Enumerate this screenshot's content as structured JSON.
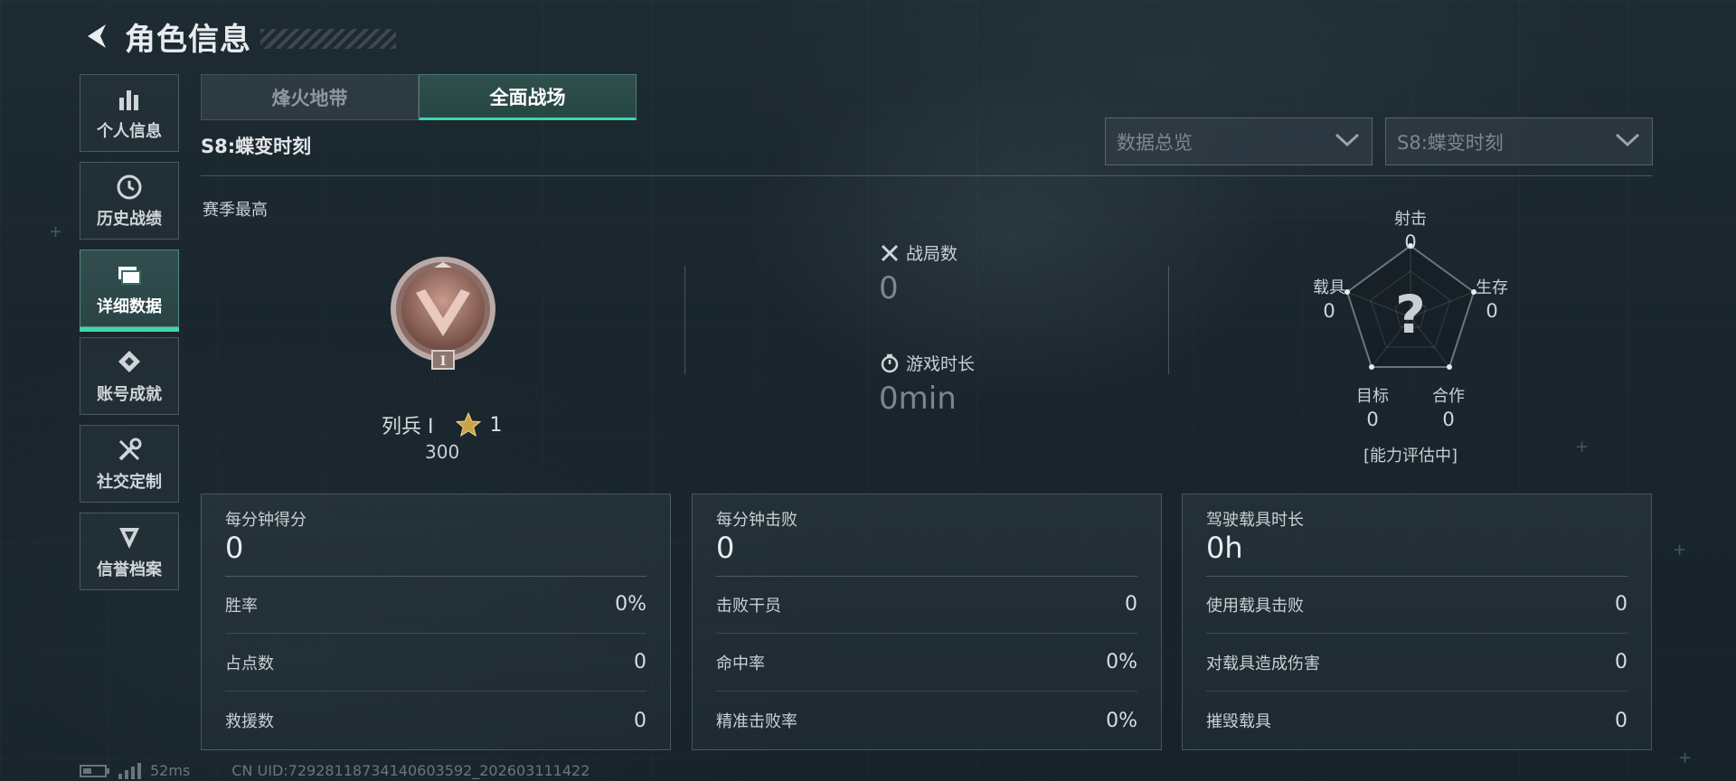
{
  "header": {
    "title": "角色信息",
    "back_icon": "chevron-left-icon"
  },
  "sidebar": {
    "items": [
      {
        "label": "个人信息",
        "icon": "bar-chart-icon",
        "active": false
      },
      {
        "label": "历史战绩",
        "icon": "clock-icon",
        "active": false
      },
      {
        "label": "详细数据",
        "icon": "folder-icon",
        "active": true
      },
      {
        "label": "账号成就",
        "icon": "medal-icon",
        "active": false
      },
      {
        "label": "社交定制",
        "icon": "wrench-icon",
        "active": false
      },
      {
        "label": "信誉档案",
        "icon": "shield-icon",
        "active": false
      }
    ]
  },
  "tabs": [
    {
      "label": "烽火地带",
      "active": false
    },
    {
      "label": "全面战场",
      "active": true
    }
  ],
  "season": {
    "title": "S8:蝶变时刻"
  },
  "filters": {
    "data_view": "数据总览",
    "season_select": "S8:蝶变时刻"
  },
  "rank": {
    "section_label": "赛季最高",
    "name": "列兵 Ⅰ",
    "stars": "1",
    "score": "300",
    "emblem_numeral": "I"
  },
  "stats": {
    "matches_label": "战局数",
    "matches_value": "0",
    "playtime_label": "游戏时长",
    "playtime_value": "0min"
  },
  "radar": {
    "center_glyph": "?",
    "status": "[能力评估中]",
    "axes": [
      {
        "label": "射击",
        "value": "0"
      },
      {
        "label": "生存",
        "value": "0"
      },
      {
        "label": "合作",
        "value": "0"
      },
      {
        "label": "目标",
        "value": "0"
      },
      {
        "label": "载具",
        "value": "0"
      }
    ]
  },
  "cards": [
    {
      "title": "每分钟得分",
      "main": "0",
      "rows": [
        {
          "label": "胜率",
          "value": "0%"
        },
        {
          "label": "占点数",
          "value": "0"
        },
        {
          "label": "救援数",
          "value": "0"
        }
      ]
    },
    {
      "title": "每分钟击败",
      "main": "0",
      "rows": [
        {
          "label": "击败干员",
          "value": "0"
        },
        {
          "label": "命中率",
          "value": "0%"
        },
        {
          "label": "精准击败率",
          "value": "0%"
        }
      ]
    },
    {
      "title": "驾驶载具时长",
      "main": "0h",
      "rows": [
        {
          "label": "使用载具击败",
          "value": "0"
        },
        {
          "label": "对载具造成伤害",
          "value": "0"
        },
        {
          "label": "摧毁载具",
          "value": "0"
        }
      ]
    }
  ],
  "footer": {
    "ping": "52ms",
    "uid": "CN UID:729281187341406035​92_202603111422"
  },
  "colors": {
    "accent": "#3fd6a8",
    "background": "#1b262e",
    "text": "#d8dde0"
  }
}
